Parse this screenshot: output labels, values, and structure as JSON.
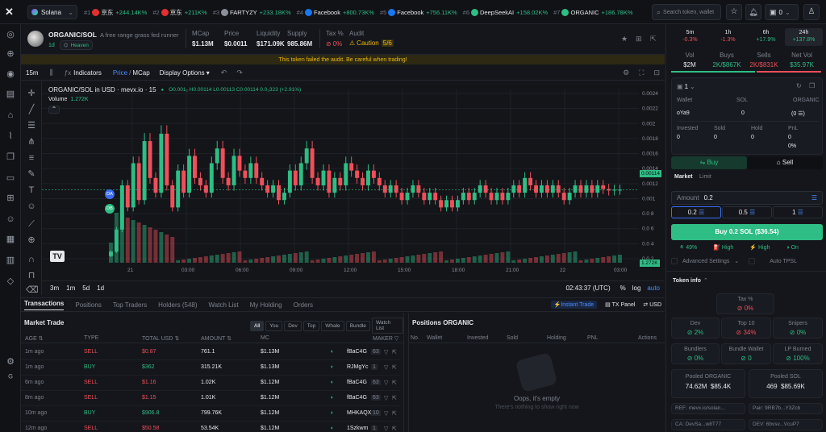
{
  "topbar": {
    "network": "Solana",
    "ticker": [
      {
        "rank": "#1",
        "name": "京东",
        "change": "+244.14K%",
        "color": "#e62e2e"
      },
      {
        "rank": "#2",
        "name": "京东",
        "change": "+211K%",
        "color": "#e62e2e"
      },
      {
        "rank": "#3",
        "name": "FARTYZY",
        "change": "+233.18K%",
        "color": "#8a8f99"
      },
      {
        "rank": "#4",
        "name": "Facebook",
        "change": "+800.73K%",
        "color": "#1877f2"
      },
      {
        "rank": "#5",
        "name": "Facebook",
        "change": "+756.11K%",
        "color": "#1877f2"
      },
      {
        "rank": "#6",
        "name": "DeepSeekAI",
        "change": "+158.02K%",
        "color": "#2ebd85"
      },
      {
        "rank": "#7",
        "name": "ORGANIC",
        "change": "+186.78K%",
        "color": "#2ebd85"
      }
    ],
    "search_placeholder": "Search token, wallet",
    "wallet_count": "0"
  },
  "token": {
    "pair": "ORGANIC/SOL",
    "desc": "A free range grass fed runner",
    "age": "1d",
    "tag": "Heaven",
    "stats": [
      {
        "label": "MCap",
        "value": "$1.13M"
      },
      {
        "label": "Price",
        "value": "$0.0011"
      },
      {
        "label": "Liquidity",
        "value": "$171.09K"
      },
      {
        "label": "Supply",
        "value": "985.86M"
      }
    ],
    "tax_label": "Tax %",
    "tax_value": "0%",
    "audit_label": "Audit",
    "audit_value": "Caution",
    "audit_score": "5/6",
    "warning": "This token failed the audit. Be careful when trading!"
  },
  "chart_toolbar": {
    "interval": "15m",
    "indicators": "Indicators",
    "price": "Price",
    "mcap": "MCap",
    "display": "Display Options"
  },
  "chart_data": {
    "type": "candlestick",
    "title": "ORGANIC/SOL in USD · mevx.io · 15",
    "ohlc": "O0.001₂ H0.00114 L0.00113 C0.00114 0.0₃323 (+2.91%)",
    "volume_label": "Volume",
    "volume_value": "1.272K",
    "yticks": [
      "0.0024",
      "0.0022",
      "0.002",
      "0.0018",
      "0.0016",
      "0.0014",
      "0.0012",
      "0.001",
      "0.0 8",
      "0.0 6",
      "0.0 4",
      "0.0 2"
    ],
    "xticks": [
      "21",
      "03:00",
      "06:00",
      "09:00",
      "12:00",
      "15:00",
      "18:00",
      "21:00",
      "22",
      "03:00"
    ],
    "ylim": [
      0.00015,
      0.0025
    ],
    "last_price": "0.00114",
    "last_volume": "1.272K",
    "closes": [
      0.0003,
      0.0006,
      0.0012,
      0.0009,
      0.0015,
      0.001,
      0.0018,
      0.0013,
      0.0011,
      0.0019,
      0.0012,
      0.0009,
      0.0014,
      0.0011,
      0.0016,
      0.0013,
      0.0012,
      0.0011,
      0.0015,
      0.0017,
      0.0013,
      0.0012,
      0.0016,
      0.0014,
      0.0013,
      0.0015,
      0.0013,
      0.0012,
      0.0011,
      0.0012,
      0.001,
      0.0011,
      0.0014,
      0.0012,
      0.0015,
      0.0017,
      0.0013,
      0.0012,
      0.0014,
      0.0011,
      0.0013,
      0.0012,
      0.0015,
      0.0014,
      0.0013,
      0.0012,
      0.0014,
      0.0013,
      0.0012,
      0.0011,
      0.0012,
      0.0011,
      0.001,
      0.0011,
      0.0012,
      0.0011,
      0.001,
      0.0011,
      0.001,
      0.0009,
      0.001,
      0.0009,
      0.001,
      0.0011,
      0.001,
      0.0011,
      0.0012,
      0.0011,
      0.001,
      0.0011,
      0.001,
      0.0011,
      0.0012,
      0.0011,
      0.0013,
      0.0012,
      0.0011,
      0.0012,
      0.0011,
      0.0012,
      0.0011,
      0.001,
      0.0011,
      0.0012,
      0.0011,
      0.0012,
      0.0011,
      0.0012,
      0.00115,
      0.00113,
      0.00114,
      0.00114
    ],
    "markers": [
      "DA",
      "DB"
    ]
  },
  "chart_bottom": {
    "ranges": [
      "3m",
      "1m",
      "5d",
      "1d"
    ],
    "time": "02:43:37 (UTC)",
    "pct": "%",
    "log": "log",
    "auto": "auto"
  },
  "tabs": [
    "Transactions",
    "Positions",
    "Top Traders",
    "Holders (548)",
    "Watch List",
    "My Holding",
    "Orders"
  ],
  "tab_right": [
    "Instant Trade",
    "TX Panel",
    "USD"
  ],
  "market": {
    "title": "Market Trade",
    "filters": [
      "All",
      "You",
      "Dev",
      "Top",
      "Whale",
      "Bundle",
      "Watch List"
    ],
    "headers": [
      "AGE",
      "TYPE",
      "TOTAL USD",
      "AMOUNT",
      "MC",
      "MAKER"
    ],
    "rows": [
      {
        "age": "1m ago",
        "type": "SELL",
        "total": "$0.87",
        "amount": "761.1",
        "mc": "$1.13M",
        "maker": "fBaC4G",
        "n": "63"
      },
      {
        "age": "1m ago",
        "type": "BUY",
        "total": "$362",
        "amount": "315.21K",
        "mc": "$1.13M",
        "maker": "RJMgYc",
        "n": "1"
      },
      {
        "age": "6m ago",
        "type": "SELL",
        "total": "$1.16",
        "amount": "1.02K",
        "mc": "$1.12M",
        "maker": "fBaC4G",
        "n": "63"
      },
      {
        "age": "8m ago",
        "type": "SELL",
        "total": "$1.15",
        "amount": "1.01K",
        "mc": "$1.12M",
        "maker": "fBaC4G",
        "n": "63"
      },
      {
        "age": "10m ago",
        "type": "BUY",
        "total": "$906.8",
        "amount": "799.76K",
        "mc": "$1.12M",
        "maker": "MHKAQX",
        "n": "10"
      },
      {
        "age": "12m ago",
        "type": "SELL",
        "total": "$50.58",
        "amount": "53.54K",
        "mc": "$1.12M",
        "maker": "1Szkwm",
        "n": "1"
      }
    ]
  },
  "positions": {
    "title": "Positions ORGANIC",
    "headers": [
      "No.",
      "Wallet",
      "Invested",
      "Sold",
      "Holding",
      "PNL",
      "Actions"
    ],
    "empty": "Oops, it's empty",
    "empty_sub": "There's nothing to show right now"
  },
  "right": {
    "periods": [
      {
        "label": "5m",
        "value": "-0.3%",
        "cls": "r"
      },
      {
        "label": "1h",
        "value": "-1.3%",
        "cls": "r"
      },
      {
        "label": "6h",
        "value": "+17.9%",
        "cls": "g"
      },
      {
        "label": "24h",
        "value": "+137.8%",
        "cls": "g"
      }
    ],
    "vol": [
      {
        "label": "Vol",
        "value": "$2M"
      },
      {
        "label": "Buys",
        "value": "2K/$867K"
      },
      {
        "label": "Sells",
        "value": "2K/$831K"
      },
      {
        "label": "Net Vol",
        "value": "$35.97K"
      }
    ],
    "wallet_count": "1",
    "wallet_head": [
      "Wallet",
      "SOL",
      "ORGANIC"
    ],
    "wallet_row": {
      "name": "oYa9",
      "sol": "0",
      "organic": "0"
    },
    "pnl_head": [
      "Invested",
      "Sold",
      "Hold",
      "PnL"
    ],
    "pnl_vals": [
      "0",
      "0",
      "0",
      "0"
    ],
    "pnl_pct": "0%",
    "buy": "Buy",
    "sell": "Sell",
    "order_tabs": [
      "Market",
      "Limit"
    ],
    "amount_label": "Amount",
    "amount_value": "0.2",
    "presets": [
      "0.2",
      "0.5",
      "1"
    ],
    "buy_btn": "Buy 0.2 SOL ($36.54)",
    "settings": [
      {
        "v": "49%"
      },
      {
        "v": "High"
      },
      {
        "v": "High"
      },
      {
        "v": "On"
      }
    ],
    "adv": "Advanced Settings",
    "autotpsl": "Auto TPSL",
    "token_info": "Token info",
    "info": [
      {
        "label": "Tax %",
        "value": "0%",
        "cls": "r"
      },
      {
        "label": "Dev",
        "value": "2%",
        "cls": "g"
      },
      {
        "label": "Top 10",
        "value": "34%",
        "cls": "r"
      },
      {
        "label": "Snipers",
        "value": "0%",
        "cls": "g"
      },
      {
        "label": "Bundlers",
        "value": "0%",
        "cls": "g"
      },
      {
        "label": "Bundle Wallet",
        "value": "0",
        "cls": "g"
      },
      {
        "label": "LP Burned",
        "value": "100%",
        "cls": "g"
      }
    ],
    "pooled": [
      {
        "label": "Pooled ORGANIC",
        "a": "74.62M",
        "b": "$85.4K"
      },
      {
        "label": "Pooled SOL",
        "a": "469",
        "b": "$85.69K"
      }
    ],
    "ref": "REF: mevx.io/solan...",
    "pair": "Pair: 9RB7b...Y3Zcb",
    "ca": "CA: DevSa...w8T77",
    "dev": "DEV: 6bvsv...VcuP7"
  }
}
